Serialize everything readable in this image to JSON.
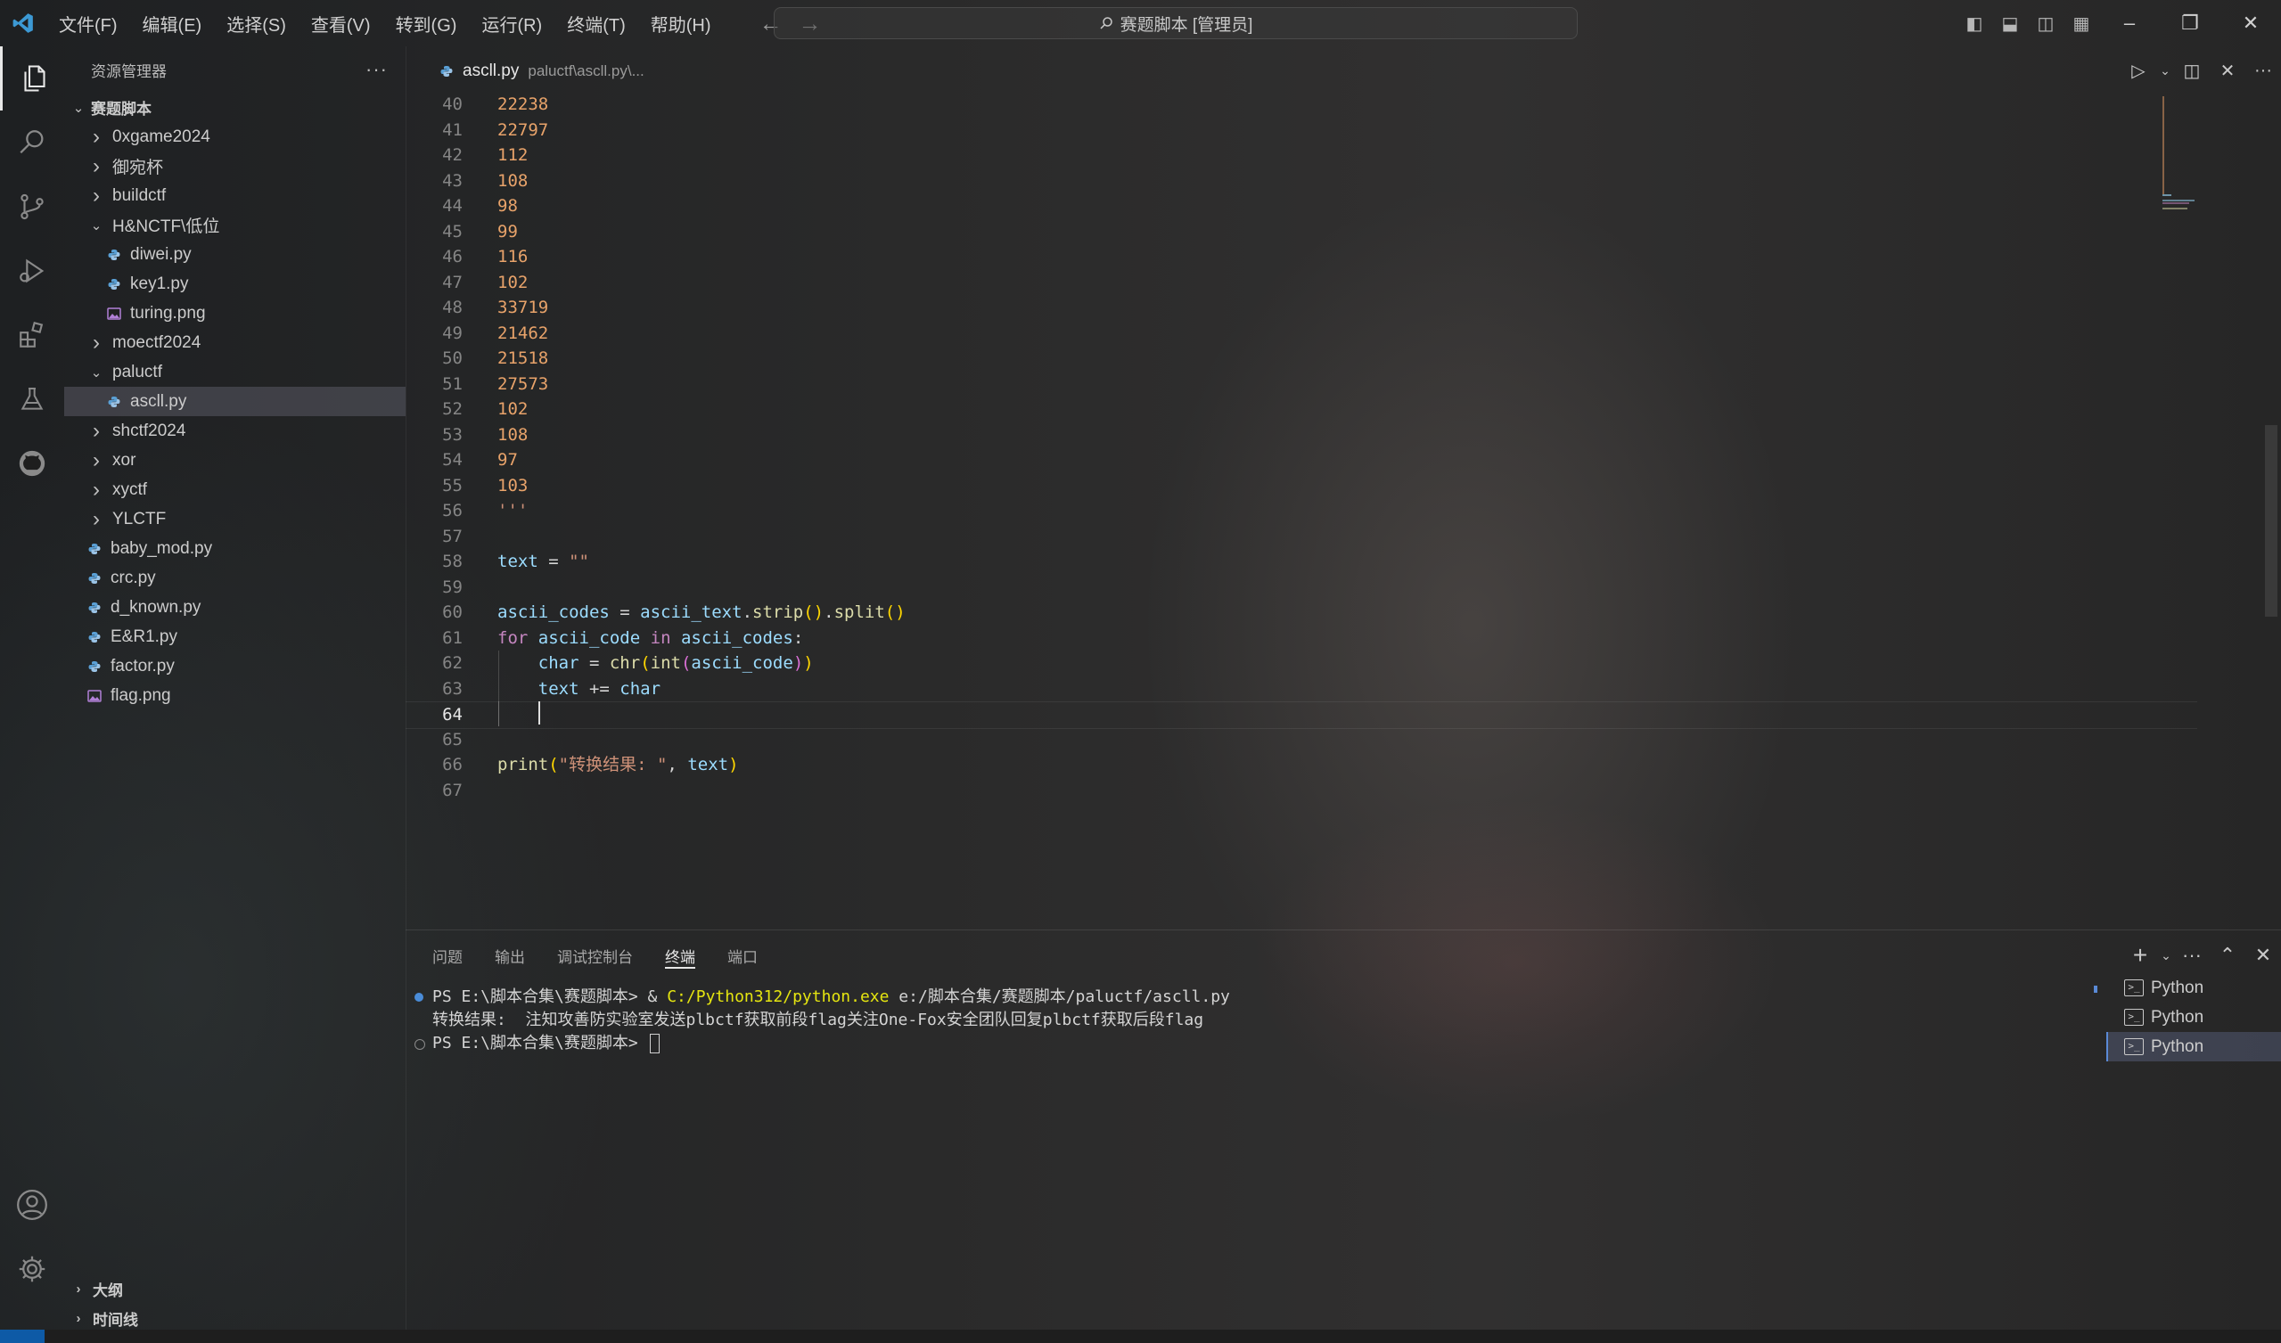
{
  "titlebar": {
    "menus": [
      "文件(F)",
      "编辑(E)",
      "选择(S)",
      "查看(V)",
      "转到(G)",
      "运行(R)",
      "终端(T)",
      "帮助(H)"
    ],
    "search_text": "赛题脚本 [管理员]"
  },
  "colors": {
    "accent": "#0e5aa6",
    "logo": "#3c99d4"
  },
  "sidebar": {
    "title": "资源管理器",
    "root": "赛题脚本",
    "tree": [
      {
        "label": "0xgame2024",
        "type": "folder",
        "depth": 1,
        "expanded": false
      },
      {
        "label": "御宛杯",
        "type": "folder",
        "depth": 1,
        "expanded": false
      },
      {
        "label": "buildctf",
        "type": "folder",
        "depth": 1,
        "expanded": false
      },
      {
        "label": "H&NCTF\\低位",
        "type": "folder",
        "depth": 1,
        "expanded": true
      },
      {
        "label": "diwei.py",
        "type": "py",
        "depth": 2
      },
      {
        "label": "key1.py",
        "type": "py",
        "depth": 2
      },
      {
        "label": "turing.png",
        "type": "img",
        "depth": 2
      },
      {
        "label": "moectf2024",
        "type": "folder",
        "depth": 1,
        "expanded": false
      },
      {
        "label": "paluctf",
        "type": "folder",
        "depth": 1,
        "expanded": true
      },
      {
        "label": "ascll.py",
        "type": "py",
        "depth": 2,
        "selected": true
      },
      {
        "label": "shctf2024",
        "type": "folder",
        "depth": 1,
        "expanded": false
      },
      {
        "label": "xor",
        "type": "folder",
        "depth": 1,
        "expanded": false
      },
      {
        "label": "xyctf",
        "type": "folder",
        "depth": 1,
        "expanded": false
      },
      {
        "label": "YLCTF",
        "type": "folder",
        "depth": 1,
        "expanded": false
      },
      {
        "label": "baby_mod.py",
        "type": "py",
        "depth": 1
      },
      {
        "label": "crc.py",
        "type": "py",
        "depth": 1
      },
      {
        "label": "d_known.py",
        "type": "py",
        "depth": 1
      },
      {
        "label": "E&R1.py",
        "type": "py",
        "depth": 1
      },
      {
        "label": "factor.py",
        "type": "py",
        "depth": 1
      },
      {
        "label": "flag.png",
        "type": "img",
        "depth": 1
      }
    ],
    "outline": "大纲",
    "timeline": "时间线"
  },
  "editor": {
    "tab_name": "ascll.py",
    "tab_path": "paluctf\\ascll.py\\...",
    "current_line": 64,
    "lines": [
      {
        "n": "40",
        "tokens": [
          [
            "num",
            "22238"
          ]
        ]
      },
      {
        "n": "41",
        "tokens": [
          [
            "num",
            "22797"
          ]
        ]
      },
      {
        "n": "42",
        "tokens": [
          [
            "num",
            "112"
          ]
        ]
      },
      {
        "n": "43",
        "tokens": [
          [
            "num",
            "108"
          ]
        ]
      },
      {
        "n": "44",
        "tokens": [
          [
            "num",
            "98"
          ]
        ]
      },
      {
        "n": "45",
        "tokens": [
          [
            "num",
            "99"
          ]
        ]
      },
      {
        "n": "46",
        "tokens": [
          [
            "num",
            "116"
          ]
        ]
      },
      {
        "n": "47",
        "tokens": [
          [
            "num",
            "102"
          ]
        ]
      },
      {
        "n": "48",
        "tokens": [
          [
            "num",
            "33719"
          ]
        ]
      },
      {
        "n": "49",
        "tokens": [
          [
            "num",
            "21462"
          ]
        ]
      },
      {
        "n": "50",
        "tokens": [
          [
            "num",
            "21518"
          ]
        ]
      },
      {
        "n": "51",
        "tokens": [
          [
            "num",
            "27573"
          ]
        ]
      },
      {
        "n": "52",
        "tokens": [
          [
            "num",
            "102"
          ]
        ]
      },
      {
        "n": "53",
        "tokens": [
          [
            "num",
            "108"
          ]
        ]
      },
      {
        "n": "54",
        "tokens": [
          [
            "num",
            "97"
          ]
        ]
      },
      {
        "n": "55",
        "tokens": [
          [
            "num",
            "103"
          ]
        ]
      },
      {
        "n": "56",
        "tokens": [
          [
            "str",
            "'''"
          ]
        ]
      },
      {
        "n": "57",
        "tokens": []
      },
      {
        "n": "58",
        "tokens": [
          [
            "var",
            "text"
          ],
          [
            "pl",
            " = "
          ],
          [
            "str",
            "\"\""
          ]
        ]
      },
      {
        "n": "59",
        "tokens": []
      },
      {
        "n": "60",
        "tokens": [
          [
            "var",
            "ascii_codes"
          ],
          [
            "pl",
            " = "
          ],
          [
            "var",
            "ascii_text"
          ],
          [
            "pl",
            "."
          ],
          [
            "fn",
            "strip"
          ],
          [
            "br1",
            "()"
          ],
          [
            "pl",
            "."
          ],
          [
            "fn",
            "split"
          ],
          [
            "br1",
            "()"
          ]
        ]
      },
      {
        "n": "61",
        "tokens": [
          [
            "kw",
            "for"
          ],
          [
            "pl",
            " "
          ],
          [
            "var",
            "ascii_code"
          ],
          [
            "pl",
            " "
          ],
          [
            "kw",
            "in"
          ],
          [
            "pl",
            " "
          ],
          [
            "var",
            "ascii_codes"
          ],
          [
            "pl",
            ":"
          ]
        ]
      },
      {
        "n": "62",
        "tokens": [
          [
            "pl",
            "    "
          ],
          [
            "var",
            "char"
          ],
          [
            "pl",
            " = "
          ],
          [
            "fn",
            "chr"
          ],
          [
            "br1",
            "("
          ],
          [
            "fn",
            "int"
          ],
          [
            "br2",
            "("
          ],
          [
            "var",
            "ascii_code"
          ],
          [
            "br2",
            ")"
          ],
          [
            "br1",
            ")"
          ]
        ]
      },
      {
        "n": "63",
        "tokens": [
          [
            "pl",
            "    "
          ],
          [
            "var",
            "text"
          ],
          [
            "pl",
            " += "
          ],
          [
            "var",
            "char"
          ]
        ]
      },
      {
        "n": "64",
        "tokens": []
      },
      {
        "n": "65",
        "tokens": []
      },
      {
        "n": "66",
        "tokens": [
          [
            "fn",
            "print"
          ],
          [
            "br1",
            "("
          ],
          [
            "str",
            "\"转换结果: \""
          ],
          [
            "pl",
            ", "
          ],
          [
            "var",
            "text"
          ],
          [
            "br1",
            ")"
          ]
        ]
      },
      {
        "n": "67",
        "tokens": []
      }
    ]
  },
  "panel": {
    "tabs": [
      "问题",
      "输出",
      "调试控制台",
      "终端",
      "端口"
    ],
    "active_tab": "终端",
    "terminal_lines": [
      {
        "dot": "blue",
        "parts": [
          [
            "pl",
            "PS E:\\脚本合集\\赛题脚本> & "
          ],
          [
            "yellow",
            "C:/Python312/python.exe"
          ],
          [
            "pl",
            " e:/脚本合集/赛题脚本/paluctf/ascll.py"
          ]
        ]
      },
      {
        "dot": "",
        "parts": [
          [
            "pl",
            "转换结果:  注知攻善防实验室发送plbctf获取前段flag关注One-Fox安全团队回复plbctf获取后段flag"
          ]
        ]
      },
      {
        "dot": "hollow",
        "parts": [
          [
            "pl",
            "PS E:\\脚本合集\\赛题脚本> "
          ]
        ]
      }
    ],
    "terminals": [
      "Python",
      "Python",
      "Python"
    ],
    "active_terminal": 2
  }
}
